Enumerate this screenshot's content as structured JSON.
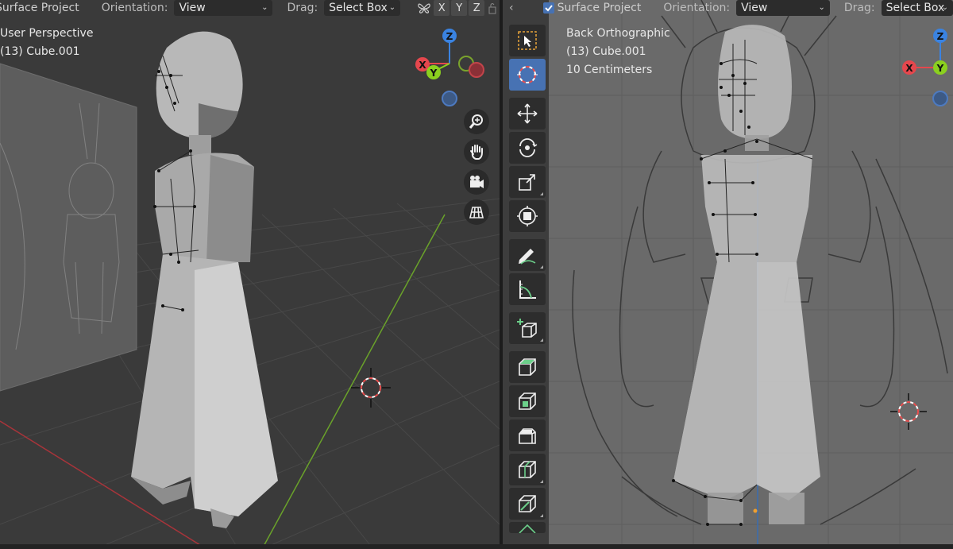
{
  "left_viewport": {
    "header": {
      "mode_label": "Surface Project",
      "orientation_label": "Orientation:",
      "orientation_value": "View",
      "drag_label": "Drag:",
      "drag_value": "Select Box",
      "axes": [
        "X",
        "Y",
        "Z"
      ]
    },
    "overlay": {
      "view_name": "User Perspective",
      "object_info": "(13) Cube.001"
    },
    "gizmo": {
      "z": "Z",
      "y": "Y",
      "x": "X"
    },
    "nav_buttons": [
      "zoom-icon",
      "hand-pan-icon",
      "camera-icon",
      "grid-icon"
    ]
  },
  "right_viewport": {
    "header": {
      "mode_label": "Surface Project",
      "orientation_label": "Orientation:",
      "orientation_value": "View",
      "drag_label": "Drag:",
      "drag_value": "Select Box"
    },
    "overlay": {
      "view_name": "Back Orthographic",
      "object_info": "(13) Cube.001",
      "scale": "10 Centimeters"
    },
    "gizmo": {
      "z": "Z",
      "y": "Y",
      "x": "X"
    },
    "toolbar": [
      "select-box-icon",
      "cursor-icon",
      "move-icon",
      "rotate-icon",
      "scale-icon",
      "transform-icon",
      "annotate-icon",
      "measure-icon",
      "add-cube-icon",
      "extrude-icon",
      "inset-icon",
      "bevel-icon",
      "loop-cut-icon",
      "knife-icon",
      "poly-build-icon"
    ]
  },
  "colors": {
    "axis_x": "#e5474d",
    "axis_y": "#8bd01f",
    "axis_z": "#3a83e1",
    "active_tool": "#4772b3",
    "grid_x_line": "#a8343a",
    "grid_y_line": "#6aa22a"
  }
}
